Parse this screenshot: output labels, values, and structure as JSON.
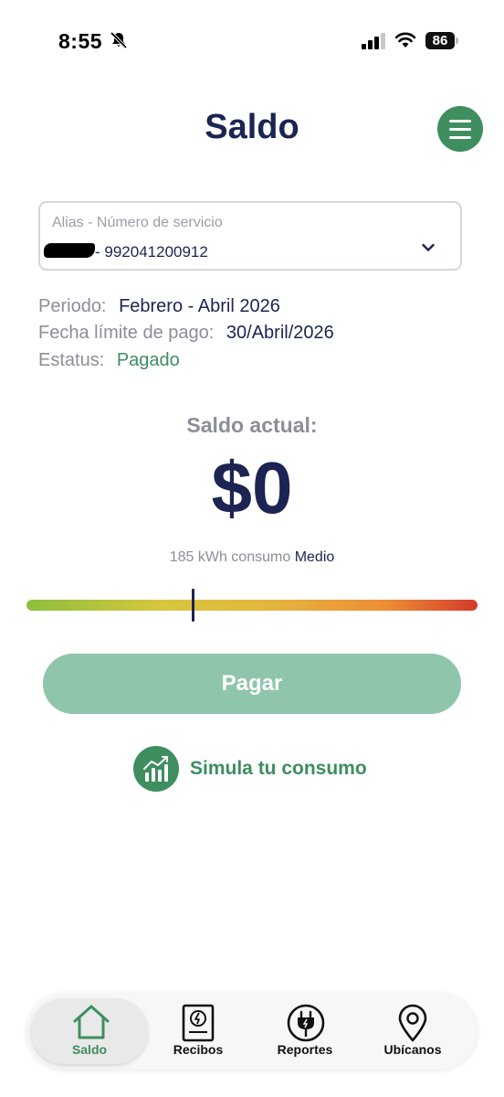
{
  "status_bar": {
    "time": "8:55",
    "battery": "86"
  },
  "header": {
    "title": "Saldo"
  },
  "service": {
    "label": "Alias - Número de servicio",
    "value": "- 992041200912"
  },
  "info": {
    "period_label": "Periodo:",
    "period_value": "Febrero - Abril 2026",
    "due_label": "Fecha límite de pago:",
    "due_value": "30/Abril/2026",
    "status_label": "Estatus:",
    "status_value": "Pagado"
  },
  "balance": {
    "label": "Saldo actual:",
    "amount": "$0",
    "consumption_text": "185 kWh consumo",
    "consumption_level": "Medio",
    "meter_level": 0.37
  },
  "actions": {
    "pay_label": "Pagar",
    "simulate_label": "Simula tu consumo"
  },
  "nav": {
    "items": [
      {
        "label": "Saldo",
        "icon": "home-icon",
        "active": true
      },
      {
        "label": "Recibos",
        "icon": "receipt-icon",
        "active": false
      },
      {
        "label": "Reportes",
        "icon": "plug-icon",
        "active": false
      },
      {
        "label": "Ubícanos",
        "icon": "location-pin-icon",
        "active": false
      }
    ]
  },
  "colors": {
    "primary_green": "#3e8e5f",
    "pay_button": "#8fc5ab",
    "navy": "#1c2453",
    "muted_text": "#8b8e99"
  }
}
